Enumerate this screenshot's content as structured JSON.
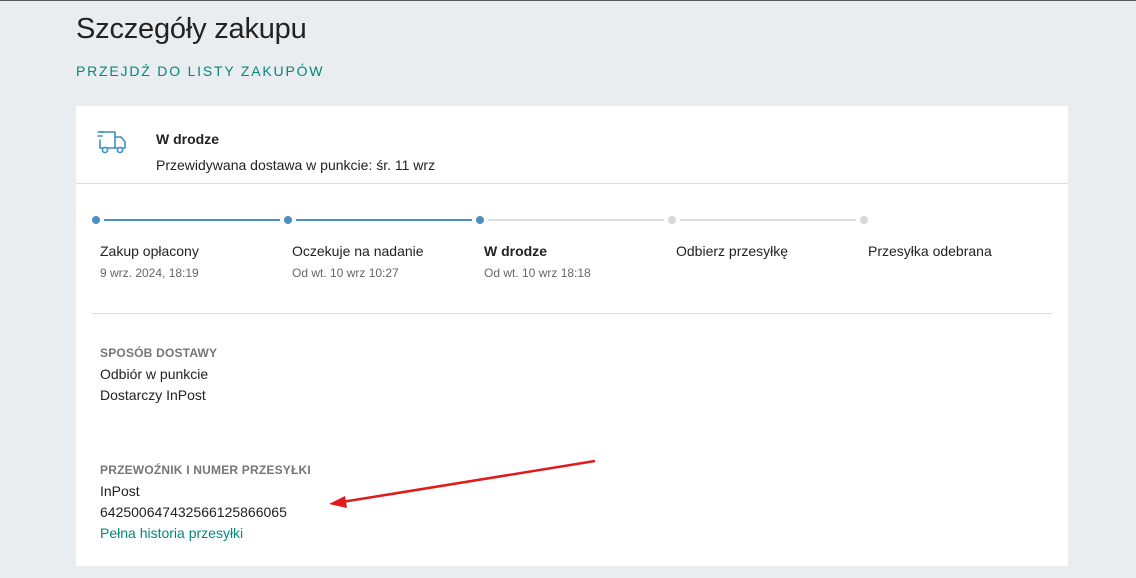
{
  "page": {
    "title": "Szczegóły zakupu",
    "back_link": "PRZEJDŹ DO LISTY ZAKUPÓW"
  },
  "status": {
    "icon": "truck-icon",
    "title": "W drodze",
    "subtitle": "Przewidywana dostawa w punkcie: śr. 11 wrz"
  },
  "steps": [
    {
      "label": "Zakup opłacony",
      "date": "9 wrz. 2024, 18:19",
      "state": "done"
    },
    {
      "label": "Oczekuje na nadanie",
      "date": "Od wt. 10 wrz 10:27",
      "state": "done"
    },
    {
      "label": "W drodze",
      "date": "Od wt. 10 wrz 18:18",
      "state": "active"
    },
    {
      "label": "Odbierz przesyłkę",
      "date": "",
      "state": "todo"
    },
    {
      "label": "Przesyłka odebrana",
      "date": "",
      "state": "todo"
    }
  ],
  "delivery": {
    "heading": "SPOSÓB DOSTAWY",
    "method": "Odbiór w punkcie",
    "carrier_line": "Dostarczy InPost"
  },
  "shipment": {
    "heading": "PRZEWOŹNIK I NUMER PRZESYŁKI",
    "carrier": "InPost",
    "tracking_number": "642500647432566125866065",
    "history_link": "Pełna historia przesyłki"
  },
  "colors": {
    "accent": "#00897b",
    "progress_done": "#4a90c2",
    "progress_todo": "#d5d8db",
    "annotation": "#e01b1b"
  }
}
